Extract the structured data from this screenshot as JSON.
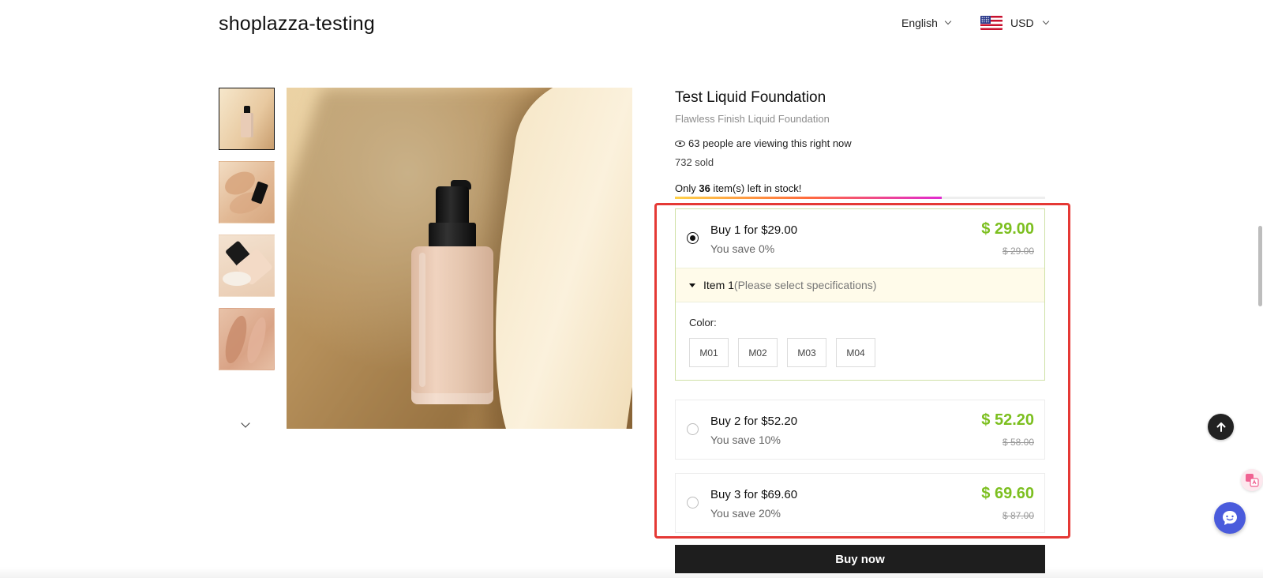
{
  "header": {
    "brand": "shoplazza-testing",
    "language": "English",
    "currency": "USD",
    "flag_icon": "us-flag-icon"
  },
  "gallery": {
    "thumbnail_count": 4,
    "active_index": 0,
    "scroll_icon": "chevron-down-icon"
  },
  "product": {
    "title": "Test Liquid Foundation",
    "subtitle": "Flawless Finish Liquid Foundation",
    "viewing_text": "63 people are viewing this right now",
    "sold_text": "732 sold",
    "stock_prefix": "Only ",
    "stock_count": "36",
    "stock_suffix": " item(s) left in stock!",
    "stock_level": 0.72
  },
  "bundles": [
    {
      "label": "Buy 1 for $29.00",
      "save": "You save 0%",
      "price": "$ 29.00",
      "original": "$ 29.00",
      "selected": true
    },
    {
      "label": "Buy 2 for $52.20",
      "save": "You save 10%",
      "price": "$ 52.20",
      "original": "$ 58.00",
      "selected": false
    },
    {
      "label": "Buy 3 for $69.60",
      "save": "You save 20%",
      "price": "$ 69.60",
      "original": "$ 87.00",
      "selected": false
    }
  ],
  "spec": {
    "item_label": "Item 1",
    "hint": "(Please select specifications)",
    "color_label": "Color:",
    "options": [
      "M01",
      "M02",
      "M03",
      "M04"
    ]
  },
  "actions": {
    "buy_now": "Buy now"
  },
  "colors": {
    "price_green": "#7cbf1f",
    "highlight_red": "#e53935",
    "button_dark": "#1e1e1e",
    "chat_blue": "#4a5bdc"
  }
}
